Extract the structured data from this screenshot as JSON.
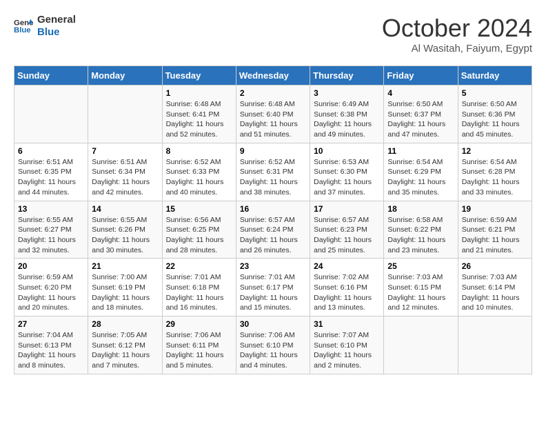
{
  "header": {
    "logo_line1": "General",
    "logo_line2": "Blue",
    "month": "October 2024",
    "location": "Al Wasitah, Faiyum, Egypt"
  },
  "weekdays": [
    "Sunday",
    "Monday",
    "Tuesday",
    "Wednesday",
    "Thursday",
    "Friday",
    "Saturday"
  ],
  "weeks": [
    [
      {
        "day": "",
        "info": ""
      },
      {
        "day": "",
        "info": ""
      },
      {
        "day": "1",
        "info": "Sunrise: 6:48 AM\nSunset: 6:41 PM\nDaylight: 11 hours and 52 minutes."
      },
      {
        "day": "2",
        "info": "Sunrise: 6:48 AM\nSunset: 6:40 PM\nDaylight: 11 hours and 51 minutes."
      },
      {
        "day": "3",
        "info": "Sunrise: 6:49 AM\nSunset: 6:38 PM\nDaylight: 11 hours and 49 minutes."
      },
      {
        "day": "4",
        "info": "Sunrise: 6:50 AM\nSunset: 6:37 PM\nDaylight: 11 hours and 47 minutes."
      },
      {
        "day": "5",
        "info": "Sunrise: 6:50 AM\nSunset: 6:36 PM\nDaylight: 11 hours and 45 minutes."
      }
    ],
    [
      {
        "day": "6",
        "info": "Sunrise: 6:51 AM\nSunset: 6:35 PM\nDaylight: 11 hours and 44 minutes."
      },
      {
        "day": "7",
        "info": "Sunrise: 6:51 AM\nSunset: 6:34 PM\nDaylight: 11 hours and 42 minutes."
      },
      {
        "day": "8",
        "info": "Sunrise: 6:52 AM\nSunset: 6:33 PM\nDaylight: 11 hours and 40 minutes."
      },
      {
        "day": "9",
        "info": "Sunrise: 6:52 AM\nSunset: 6:31 PM\nDaylight: 11 hours and 38 minutes."
      },
      {
        "day": "10",
        "info": "Sunrise: 6:53 AM\nSunset: 6:30 PM\nDaylight: 11 hours and 37 minutes."
      },
      {
        "day": "11",
        "info": "Sunrise: 6:54 AM\nSunset: 6:29 PM\nDaylight: 11 hours and 35 minutes."
      },
      {
        "day": "12",
        "info": "Sunrise: 6:54 AM\nSunset: 6:28 PM\nDaylight: 11 hours and 33 minutes."
      }
    ],
    [
      {
        "day": "13",
        "info": "Sunrise: 6:55 AM\nSunset: 6:27 PM\nDaylight: 11 hours and 32 minutes."
      },
      {
        "day": "14",
        "info": "Sunrise: 6:55 AM\nSunset: 6:26 PM\nDaylight: 11 hours and 30 minutes."
      },
      {
        "day": "15",
        "info": "Sunrise: 6:56 AM\nSunset: 6:25 PM\nDaylight: 11 hours and 28 minutes."
      },
      {
        "day": "16",
        "info": "Sunrise: 6:57 AM\nSunset: 6:24 PM\nDaylight: 11 hours and 26 minutes."
      },
      {
        "day": "17",
        "info": "Sunrise: 6:57 AM\nSunset: 6:23 PM\nDaylight: 11 hours and 25 minutes."
      },
      {
        "day": "18",
        "info": "Sunrise: 6:58 AM\nSunset: 6:22 PM\nDaylight: 11 hours and 23 minutes."
      },
      {
        "day": "19",
        "info": "Sunrise: 6:59 AM\nSunset: 6:21 PM\nDaylight: 11 hours and 21 minutes."
      }
    ],
    [
      {
        "day": "20",
        "info": "Sunrise: 6:59 AM\nSunset: 6:20 PM\nDaylight: 11 hours and 20 minutes."
      },
      {
        "day": "21",
        "info": "Sunrise: 7:00 AM\nSunset: 6:19 PM\nDaylight: 11 hours and 18 minutes."
      },
      {
        "day": "22",
        "info": "Sunrise: 7:01 AM\nSunset: 6:18 PM\nDaylight: 11 hours and 16 minutes."
      },
      {
        "day": "23",
        "info": "Sunrise: 7:01 AM\nSunset: 6:17 PM\nDaylight: 11 hours and 15 minutes."
      },
      {
        "day": "24",
        "info": "Sunrise: 7:02 AM\nSunset: 6:16 PM\nDaylight: 11 hours and 13 minutes."
      },
      {
        "day": "25",
        "info": "Sunrise: 7:03 AM\nSunset: 6:15 PM\nDaylight: 11 hours and 12 minutes."
      },
      {
        "day": "26",
        "info": "Sunrise: 7:03 AM\nSunset: 6:14 PM\nDaylight: 11 hours and 10 minutes."
      }
    ],
    [
      {
        "day": "27",
        "info": "Sunrise: 7:04 AM\nSunset: 6:13 PM\nDaylight: 11 hours and 8 minutes."
      },
      {
        "day": "28",
        "info": "Sunrise: 7:05 AM\nSunset: 6:12 PM\nDaylight: 11 hours and 7 minutes."
      },
      {
        "day": "29",
        "info": "Sunrise: 7:06 AM\nSunset: 6:11 PM\nDaylight: 11 hours and 5 minutes."
      },
      {
        "day": "30",
        "info": "Sunrise: 7:06 AM\nSunset: 6:10 PM\nDaylight: 11 hours and 4 minutes."
      },
      {
        "day": "31",
        "info": "Sunrise: 7:07 AM\nSunset: 6:10 PM\nDaylight: 11 hours and 2 minutes."
      },
      {
        "day": "",
        "info": ""
      },
      {
        "day": "",
        "info": ""
      }
    ]
  ]
}
